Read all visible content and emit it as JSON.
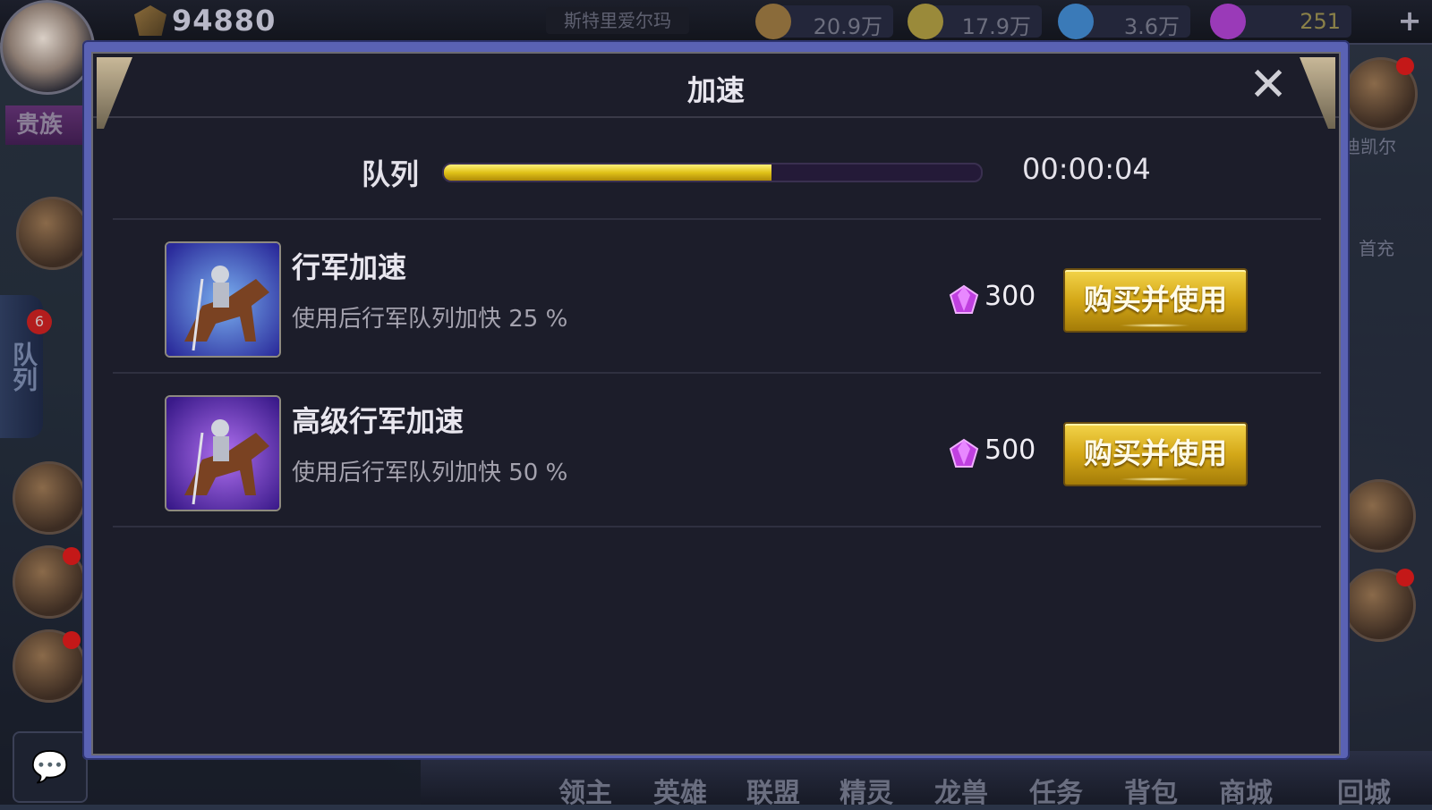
{
  "hud": {
    "power": "94880",
    "player_name": "斯特里爱尔玛",
    "resources": [
      {
        "icon": "wood-icon",
        "value": "20.9万",
        "color": "#8a6b3a"
      },
      {
        "icon": "wheat-icon",
        "value": "17.9万",
        "color": "#9a8a3a"
      },
      {
        "icon": "mana-icon",
        "value": "3.6万",
        "color": "#3a7ab8"
      },
      {
        "icon": "gem-icon",
        "value": "251",
        "color": "#9a3ab8"
      }
    ],
    "noble_label": "贵族",
    "queue_tab_label": "队列",
    "queue_badge": "6",
    "right_labels": [
      "迪凯尔",
      "首充"
    ],
    "bottom_nav": [
      "领主",
      "英雄",
      "联盟",
      "精灵",
      "龙兽",
      "任务",
      "背包",
      "商城",
      "回城"
    ]
  },
  "dialog": {
    "title": "加速",
    "queue_label": "队列",
    "timer": "00:00:04",
    "progress": 0.61,
    "items": [
      {
        "name": "行军加速",
        "desc": "使用后行军队列加快 25 %",
        "price": "300",
        "button": "购买并使用",
        "icon_bg": "#3c5ab8"
      },
      {
        "name": "高级行军加速",
        "desc": "使用后行军队列加快 50 %",
        "price": "500",
        "button": "购买并使用",
        "icon_bg": "#6a2ab0"
      }
    ]
  },
  "colors": {
    "accent_gold": "#e0c218",
    "gem_purple": "#c040e0"
  }
}
